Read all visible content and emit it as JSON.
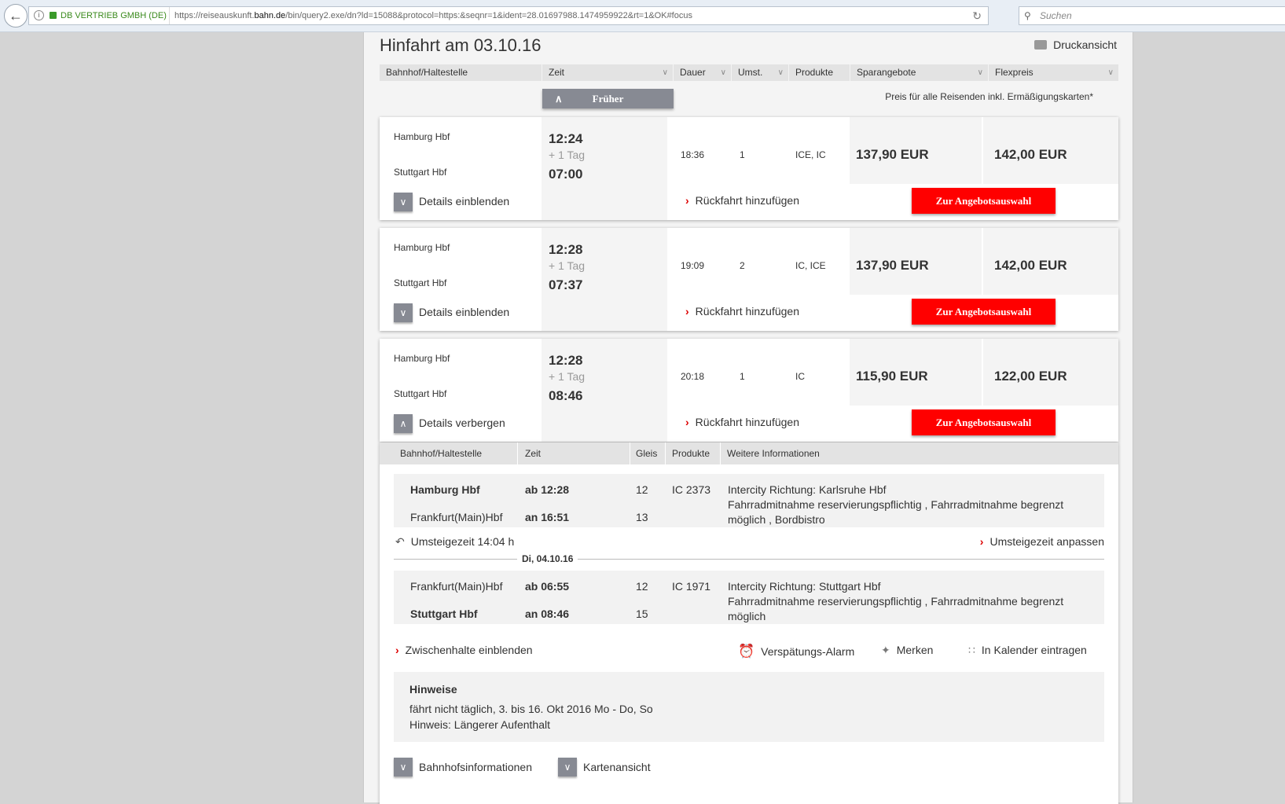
{
  "browser": {
    "site_identity": "DB VERTRIEB GMBH (DE)",
    "url_prefix": "https://reiseauskunft.",
    "url_domain": "bahn.de",
    "url_path": "/bin/query2.exe/dn?ld=15088&protocol=https:&seqnr=1&ident=28.01697988.1474959922&rt=1&OK#focus",
    "search_placeholder": "Suchen"
  },
  "page": {
    "title": "Hinfahrt am 03.10.16",
    "print_label": "Druckansicht",
    "earlier_label": "Früher",
    "price_note": "Preis für alle Reisenden inkl. Ermäßigungskarten*"
  },
  "columns": [
    "Bahnhof/Haltestelle",
    "Zeit",
    "Dauer",
    "Umst.",
    "Produkte",
    "Sparangebote",
    "Flexpreis"
  ],
  "connections": [
    {
      "from": "Hamburg Hbf",
      "to": "Stuttgart Hbf",
      "dep": "12:24",
      "day_offset": "+ 1 Tag",
      "arr": "07:00",
      "duration": "18:36",
      "changes": "1",
      "products": "ICE, IC",
      "saver": "137,90 EUR",
      "flex": "142,00 EUR",
      "toggle": "Details einblenden",
      "return": "Rückfahrt hinzufügen",
      "offer": "Zur Angebotsauswahl"
    },
    {
      "from": "Hamburg Hbf",
      "to": "Stuttgart Hbf",
      "dep": "12:28",
      "day_offset": "+ 1 Tag",
      "arr": "07:37",
      "duration": "19:09",
      "changes": "2",
      "products": "IC, ICE",
      "saver": "137,90 EUR",
      "flex": "142,00 EUR",
      "toggle": "Details einblenden",
      "return": "Rückfahrt hinzufügen",
      "offer": "Zur Angebotsauswahl"
    },
    {
      "from": "Hamburg Hbf",
      "to": "Stuttgart Hbf",
      "dep": "12:28",
      "day_offset": "+ 1 Tag",
      "arr": "08:46",
      "duration": "20:18",
      "changes": "1",
      "products": "IC",
      "saver": "115,90 EUR",
      "flex": "122,00 EUR",
      "toggle": "Details verbergen",
      "return": "Rückfahrt hinzufügen",
      "offer": "Zur Angebotsauswahl"
    }
  ],
  "details": {
    "columns": [
      "Bahnhof/Haltestelle",
      "Zeit",
      "Gleis",
      "Produkte",
      "Weitere Informationen"
    ],
    "segments": [
      {
        "dep_station": "Hamburg Hbf",
        "dep_time": "ab 12:28",
        "dep_track": "12",
        "arr_station": "Frankfurt(Main)Hbf",
        "arr_time": "an 16:51",
        "arr_track": "13",
        "product": "IC 2373",
        "info": [
          "Intercity Richtung: Karlsruhe Hbf",
          "Fahrradmitnahme reservierungspflichtig , Fahrradmitnahme begrenzt",
          "möglich , Bordbistro"
        ]
      },
      {
        "dep_station": "Frankfurt(Main)Hbf",
        "dep_time": "ab 06:55",
        "dep_track": "12",
        "arr_station": "Stuttgart Hbf",
        "arr_time": "an 08:46",
        "arr_track": "15",
        "product": "IC 1971",
        "info": [
          "Intercity Richtung: Stuttgart Hbf",
          "Fahrradmitnahme reservierungspflichtig , Fahrradmitnahme begrenzt",
          "möglich"
        ]
      }
    ],
    "transfer": "Umsteigezeit 14:04 h",
    "adjust": "Umsteigezeit anpassen",
    "date_divider": "Di, 04.10.16",
    "intermediate": "Zwischenhalte einblenden",
    "alarm": "Verspätungs-Alarm",
    "save": "Merken",
    "calendar": "In Kalender eintragen",
    "hints_title": "Hinweise",
    "hints": [
      "fährt nicht täglich, 3. bis 16. Okt 2016 Mo - Do, So",
      "Hinweis: Längerer Aufenthalt"
    ],
    "station_info": "Bahnhofsinformationen",
    "map_view": "Kartenansicht"
  },
  "colors": {
    "accent_red": "#ff0000",
    "button_grey": "#878a93"
  }
}
